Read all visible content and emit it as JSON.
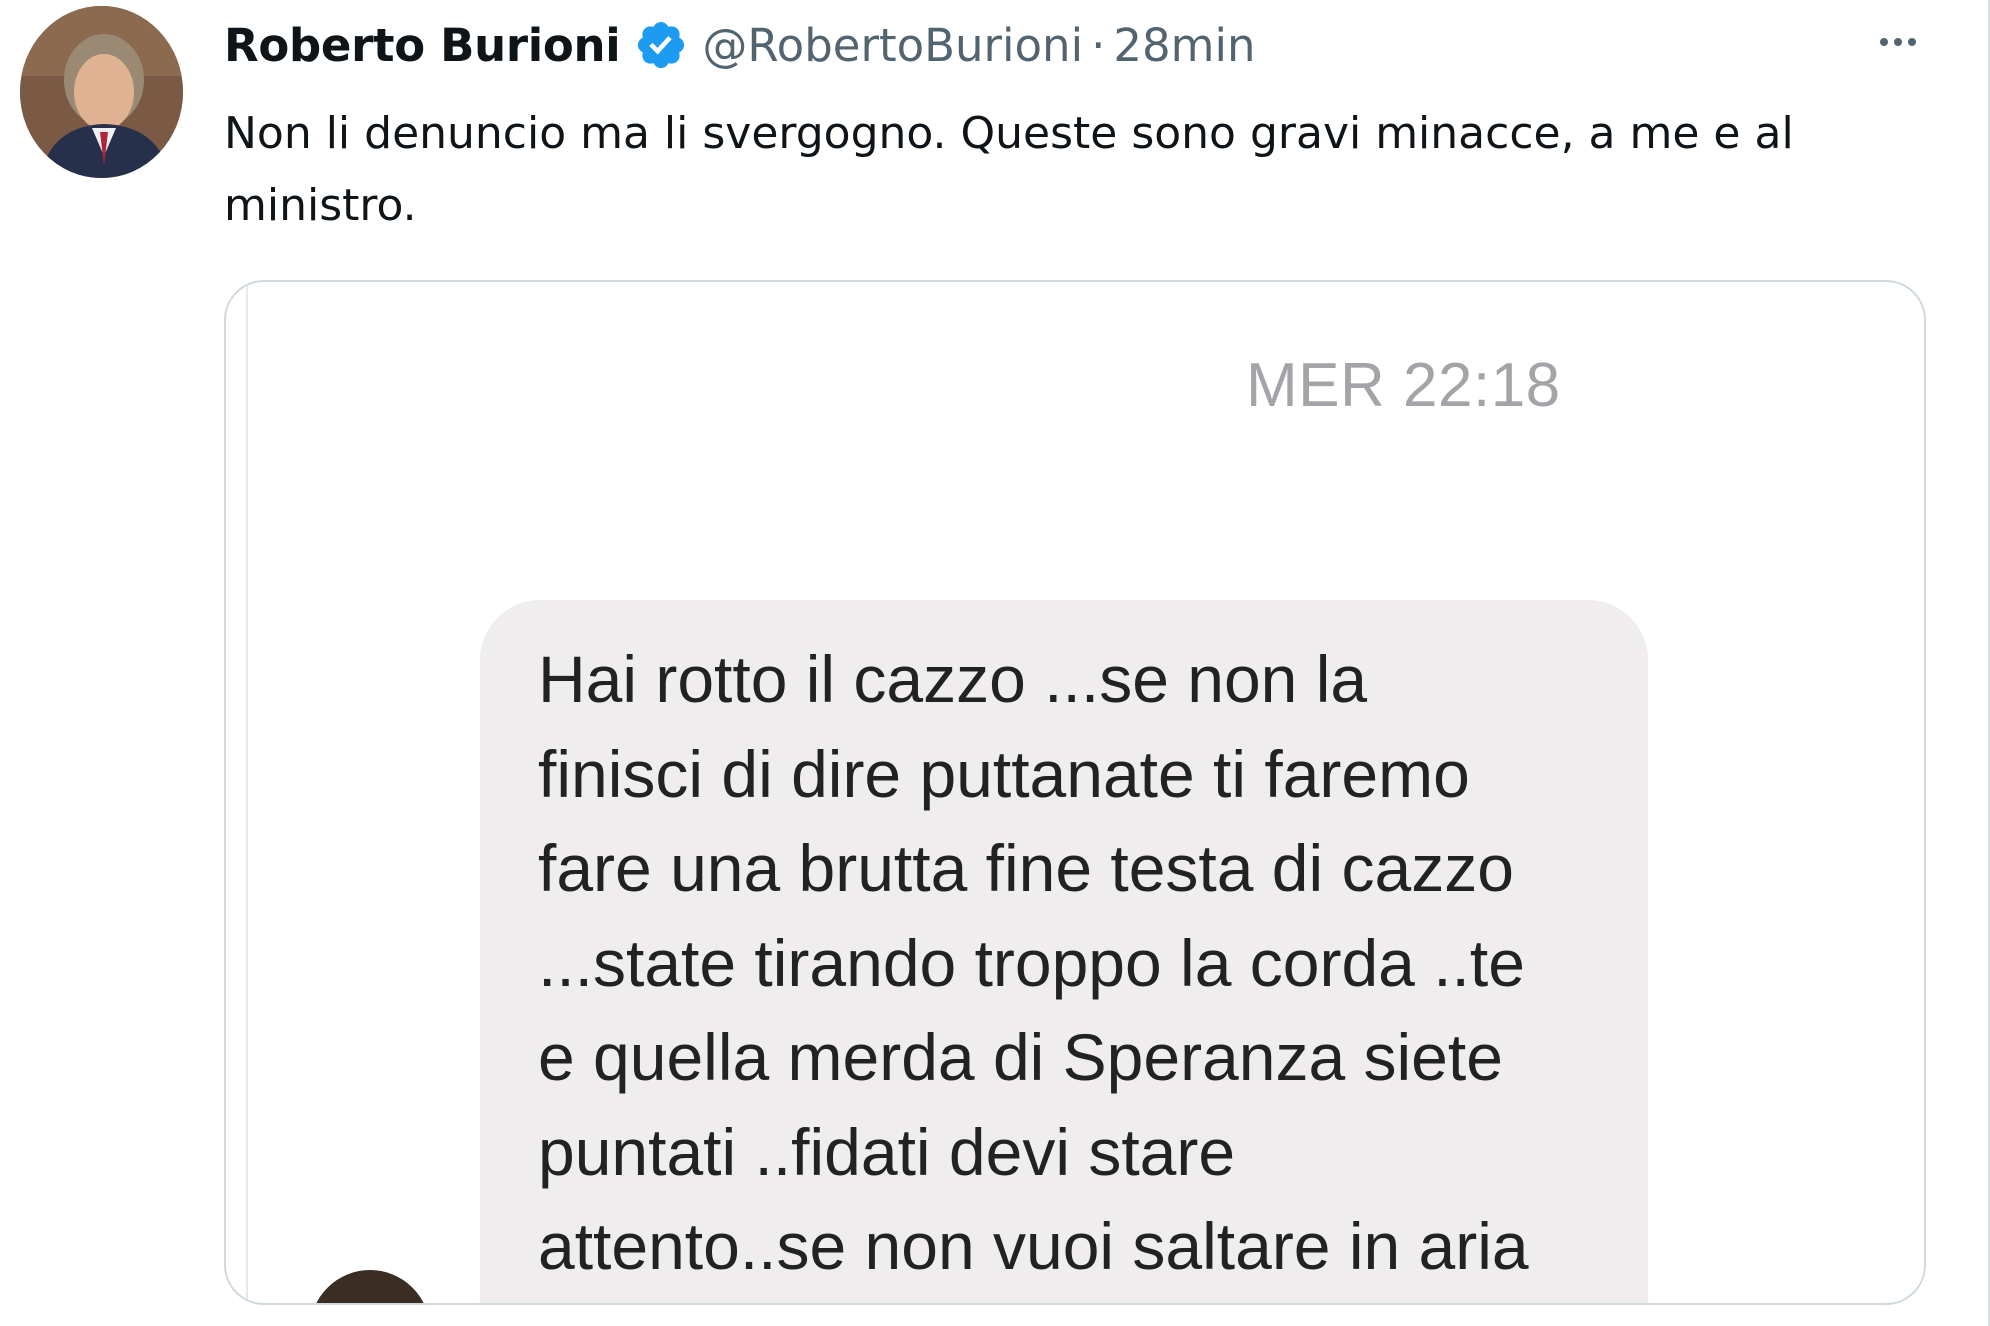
{
  "tweet": {
    "author_name": "Roberto Burioni",
    "handle": "@RobertoBurioni",
    "separator": "·",
    "time": "28min",
    "text": "Non li denuncio ma li svergogno. Queste sono gravi minacce, a me e al ministro."
  },
  "media": {
    "timestamp": "MER 22:18",
    "message": "Hai rotto il cazzo ...se non la\nfinisci di dire puttanate ti faremo\nfare una brutta fine testa di cazzo\n...state tirando troppo la corda ..te\ne quella merda di Speranza siete\npuntati ..fidati devi stare\nattento..se non vuoi saltare in aria"
  },
  "icons": {
    "verified": "verified-badge-icon",
    "more": "more-options-icon"
  },
  "colors": {
    "verified_blue": "#1d9bf0",
    "text_primary": "#0f1419",
    "text_secondary": "#536471",
    "bubble": "#efedee"
  }
}
